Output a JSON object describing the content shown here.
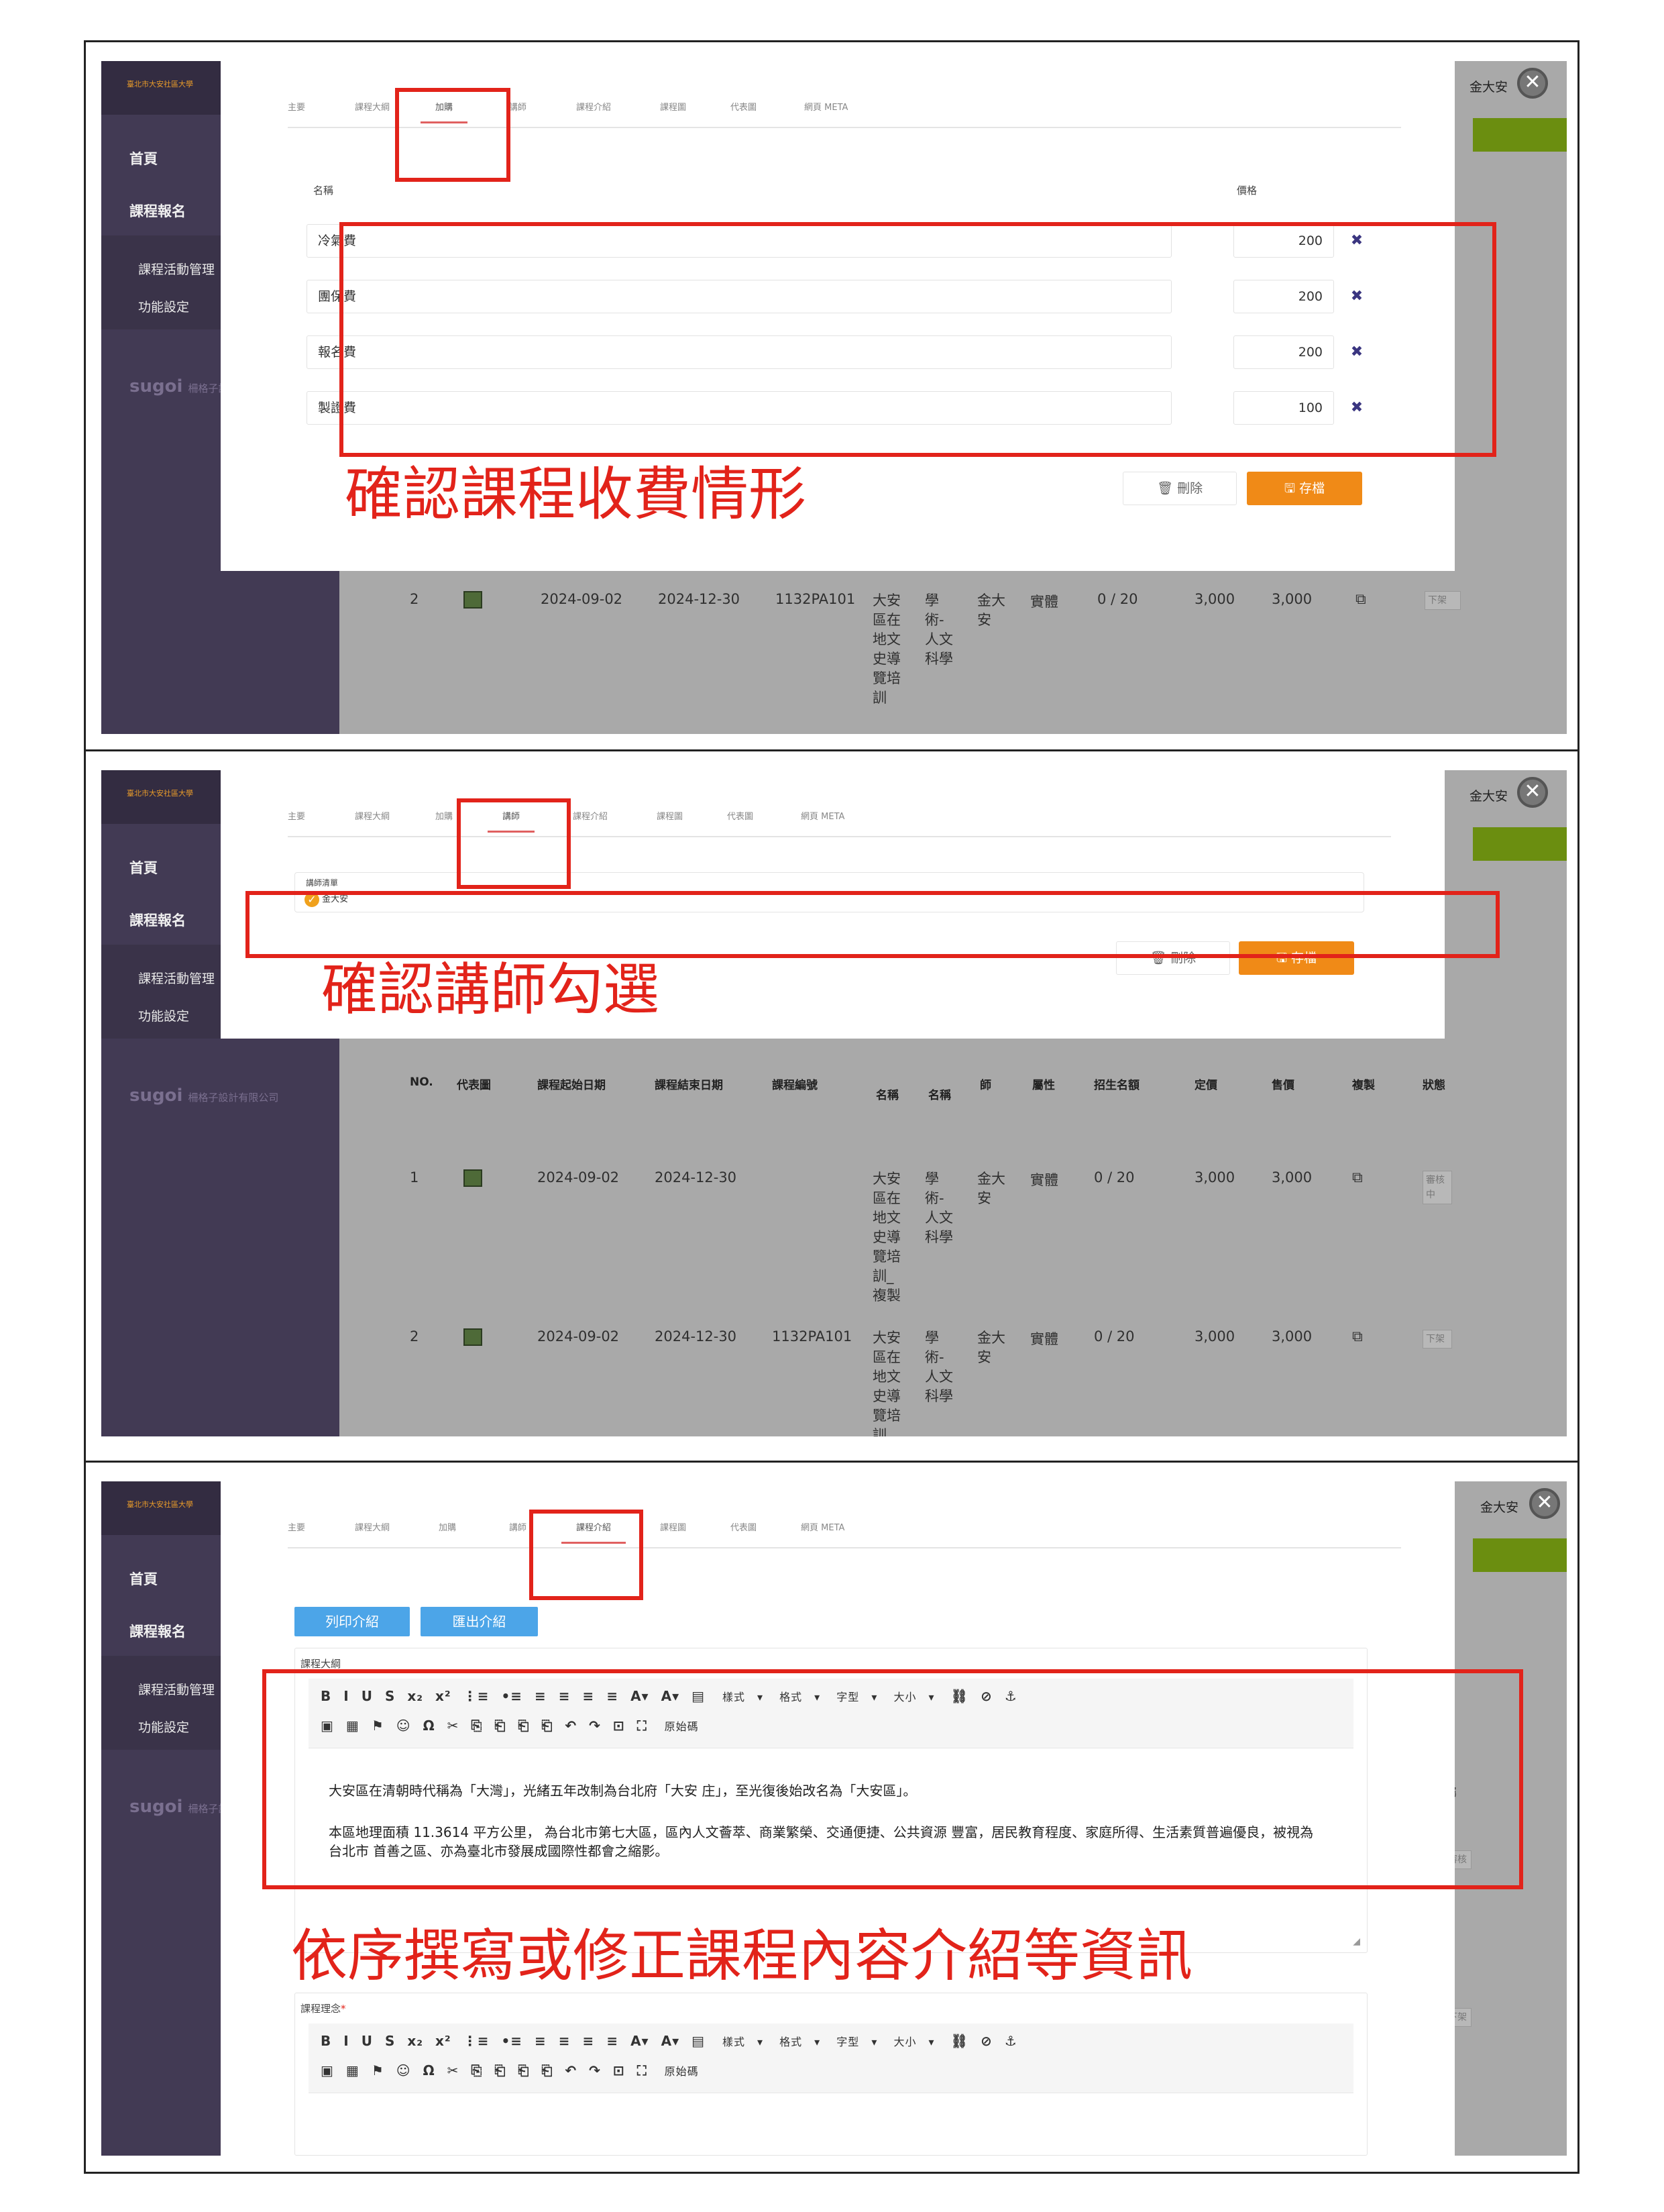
{
  "common": {
    "logo_text": "臺北市大安社區大學",
    "sidebar": {
      "home": "首頁",
      "registration": "課程報名",
      "activity_mgmt": "課程活動管理",
      "settings": "功能設定",
      "brand": "sugoi",
      "brand_company": "柵格子設計有限公司"
    },
    "user_name": "金大安",
    "close_glyph": "✕",
    "tabs": [
      "主要",
      "課程大綱",
      "加購",
      "講師",
      "課程介紹",
      "課程圖",
      "代表圖",
      "網頁 META"
    ],
    "delete_label": "刪除",
    "save_label": "存檔",
    "colors": {
      "annotation_red": "#e2231a",
      "save_orange": "#f08a17",
      "sidebar_purple": "#423a54",
      "accent_green": "#6b8e10",
      "tab_underline": "#e06060"
    }
  },
  "panel1": {
    "active_tab": "加購",
    "col_name": "名稱",
    "col_price": "價格",
    "items": [
      {
        "name": "冷氣費",
        "price": "200"
      },
      {
        "name": "團保費",
        "price": "200"
      },
      {
        "name": "報名費",
        "price": "200"
      },
      {
        "name": "製證費",
        "price": "100"
      }
    ],
    "remove_glyph": "✖",
    "caption": "確認課程收費情形",
    "bg_row": {
      "no": "2",
      "start": "2024-09-02",
      "end": "2024-12-30",
      "code": "1132PA101",
      "name_col": "大安區在地文史導覽培訓",
      "cat_col": "學術-人文科學",
      "teacher": "金大安",
      "mode": "實體",
      "enroll": "0 / 20",
      "price": "3,000",
      "sale": "3,000",
      "status": "下架"
    }
  },
  "panel2": {
    "active_tab": "講師",
    "teacher_list_label": "講師清單",
    "teacher_checked": "金大安",
    "caption": "確認講師勾選",
    "headers": [
      "NO.",
      "代表圖",
      "課程起始日期",
      "課程結束日期",
      "課程編號",
      "名稱",
      "名稱",
      "師",
      "屬性",
      "招生名額",
      "定價",
      "售價",
      "複製",
      "狀態"
    ],
    "rows": [
      {
        "no": "1",
        "start": "2024-09-02",
        "end": "2024-12-30",
        "code": "",
        "name_col": "大安區在地文史導覽培訓_複製",
        "cat_col": "學術-人文科學",
        "teacher": "金大安",
        "mode": "實體",
        "enroll": "0 / 20",
        "price": "3,000",
        "sale": "3,000",
        "status": "審核中"
      },
      {
        "no": "2",
        "start": "2024-09-02",
        "end": "2024-12-30",
        "code": "1132PA101",
        "name_col": "大安區在地文史導覽培訓",
        "cat_col": "學術-人文科學",
        "teacher": "金大安",
        "mode": "實體",
        "enroll": "0 / 20",
        "price": "3,000",
        "sale": "3,000",
        "status": "下架"
      }
    ]
  },
  "panel3": {
    "active_tab": "課程介紹",
    "print_btn": "列印介紹",
    "export_btn": "匯出介紹",
    "outline_label": "課程大綱",
    "concept_label": "課程理念",
    "required_mark": "*",
    "toolbar_row1": [
      "B",
      "I",
      "U",
      "S",
      "x₂",
      "x²",
      "⋮≡",
      "•≡",
      "≡",
      "≡",
      "≡",
      "≡",
      "A▾",
      "A▾",
      "▤"
    ],
    "toolbar_row2": [
      "▣",
      "▦",
      "⚑",
      "☺",
      "Ω",
      "✂",
      "⎘",
      "⎗",
      "⎗",
      "⎗",
      "↶",
      "↷",
      "⊡",
      "⛶"
    ],
    "select_style": "樣式",
    "select_format": "格式",
    "select_font": "字型",
    "select_size": "大小",
    "source_btn": "原始碼",
    "para1": "大安區在清朝時代稱為「大灣」，光緒五年改制為台北府「大安 庄」，至光復後始改名為「大安區」。",
    "para2": "本區地理面積 11.3614 平方公里， 為台北市第七大區，區內人文薈萃、商業繁榮、交通便捷、公共資源 豐富，居民教育程度、家庭所得、生活素質普遍優良，被視為台北市 首善之區、亦為臺北市發展成國際性都會之縮影。",
    "caption": "依序撰寫或修正課程內容介紹等資訊",
    "bg_label_1": "屬",
    "bg_status": "審核",
    "bg_status2": "下架"
  }
}
